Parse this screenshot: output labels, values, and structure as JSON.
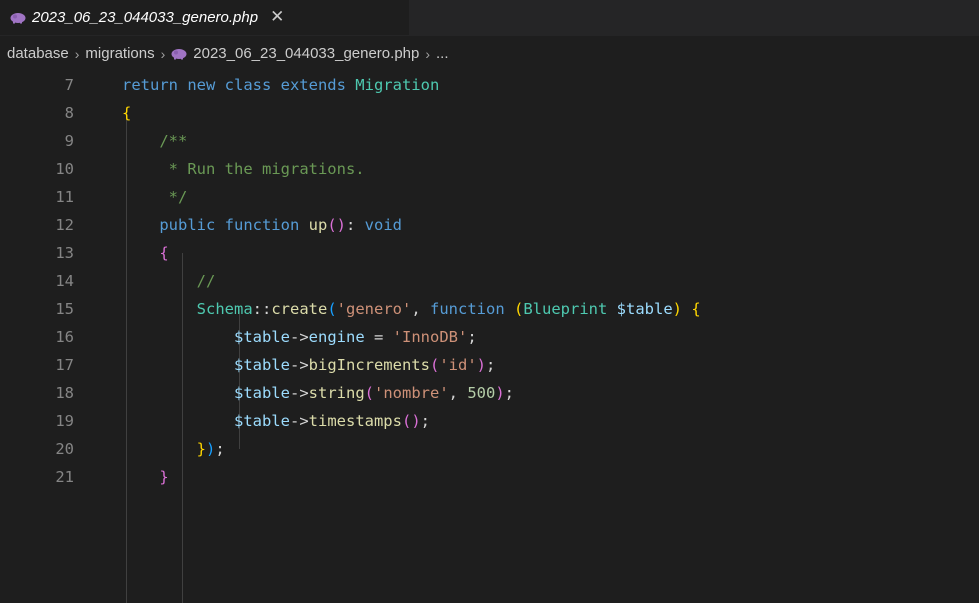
{
  "tab": {
    "title": "2023_06_23_044033_genero.php",
    "close": "✕",
    "icon": "php-elephant-icon"
  },
  "breadcrumb": {
    "items": [
      "database",
      "migrations",
      "2023_06_23_044033_genero.php",
      "..."
    ],
    "separator": "›"
  },
  "colors": {
    "background": "#1e1e1e",
    "keyword": "#569cd6",
    "class": "#4ec9b0",
    "function": "#dcdcaa",
    "variable": "#9cdcfe",
    "string": "#ce9178",
    "comment": "#6a9955"
  },
  "code": {
    "lines": [
      {
        "n": "7",
        "tokens": [
          [
            "kw",
            "return new class extends "
          ],
          [
            "cls",
            "Migration"
          ]
        ]
      },
      {
        "n": "8",
        "tokens": [
          [
            "b1",
            "{"
          ]
        ]
      },
      {
        "n": "9",
        "tokens": [
          [
            "pl",
            "    "
          ],
          [
            "cmt",
            "/**"
          ]
        ]
      },
      {
        "n": "10",
        "tokens": [
          [
            "pl",
            "     "
          ],
          [
            "cmt",
            "* Run the migrations."
          ]
        ]
      },
      {
        "n": "11",
        "tokens": [
          [
            "pl",
            "     "
          ],
          [
            "cmt",
            "*/"
          ]
        ]
      },
      {
        "n": "12",
        "tokens": [
          [
            "pl",
            "    "
          ],
          [
            "kw",
            "public function "
          ],
          [
            "fn",
            "up"
          ],
          [
            "b2",
            "()"
          ],
          [
            "pl",
            ": "
          ],
          [
            "kw",
            "void"
          ]
        ]
      },
      {
        "n": "13",
        "tokens": [
          [
            "pl",
            "    "
          ],
          [
            "b2",
            "{"
          ]
        ]
      },
      {
        "n": "14",
        "tokens": [
          [
            "pl",
            "        "
          ],
          [
            "cmt",
            "//"
          ]
        ]
      },
      {
        "n": "15",
        "tokens": [
          [
            "pl",
            "        "
          ],
          [
            "cls",
            "Schema"
          ],
          [
            "pl",
            "::"
          ],
          [
            "fn",
            "create"
          ],
          [
            "b3",
            "("
          ],
          [
            "str",
            "'genero'"
          ],
          [
            "pl",
            ", "
          ],
          [
            "kw",
            "function "
          ],
          [
            "b1",
            "("
          ],
          [
            "cls",
            "Blueprint "
          ],
          [
            "var",
            "$table"
          ],
          [
            "b1",
            ")"
          ],
          [
            "pl",
            " "
          ],
          [
            "b1",
            "{"
          ]
        ]
      },
      {
        "n": "16",
        "tokens": [
          [
            "pl",
            "            "
          ],
          [
            "var",
            "$table"
          ],
          [
            "pl",
            "->"
          ],
          [
            "var",
            "engine"
          ],
          [
            "pl",
            " = "
          ],
          [
            "str",
            "'InnoDB'"
          ],
          [
            "pl",
            ";"
          ]
        ]
      },
      {
        "n": "17",
        "tokens": [
          [
            "pl",
            "            "
          ],
          [
            "var",
            "$table"
          ],
          [
            "pl",
            "->"
          ],
          [
            "fn",
            "bigIncrements"
          ],
          [
            "b2",
            "("
          ],
          [
            "str",
            "'id'"
          ],
          [
            "b2",
            ")"
          ],
          [
            "pl",
            ";"
          ]
        ]
      },
      {
        "n": "18",
        "tokens": [
          [
            "pl",
            "            "
          ],
          [
            "var",
            "$table"
          ],
          [
            "pl",
            "->"
          ],
          [
            "fn",
            "string"
          ],
          [
            "b2",
            "("
          ],
          [
            "str",
            "'nombre'"
          ],
          [
            "pl",
            ", "
          ],
          [
            "num",
            "500"
          ],
          [
            "b2",
            ")"
          ],
          [
            "pl",
            ";"
          ]
        ]
      },
      {
        "n": "19",
        "tokens": [
          [
            "pl",
            "            "
          ],
          [
            "var",
            "$table"
          ],
          [
            "pl",
            "->"
          ],
          [
            "fn",
            "timestamps"
          ],
          [
            "b2",
            "()"
          ],
          [
            "pl",
            ";"
          ]
        ]
      },
      {
        "n": "20",
        "tokens": [
          [
            "pl",
            "        "
          ],
          [
            "b1",
            "}"
          ],
          [
            "b3",
            ")"
          ],
          [
            "pl",
            ";"
          ]
        ]
      },
      {
        "n": "21",
        "tokens": [
          [
            "pl",
            "    "
          ],
          [
            "b2",
            "}"
          ]
        ]
      }
    ]
  }
}
